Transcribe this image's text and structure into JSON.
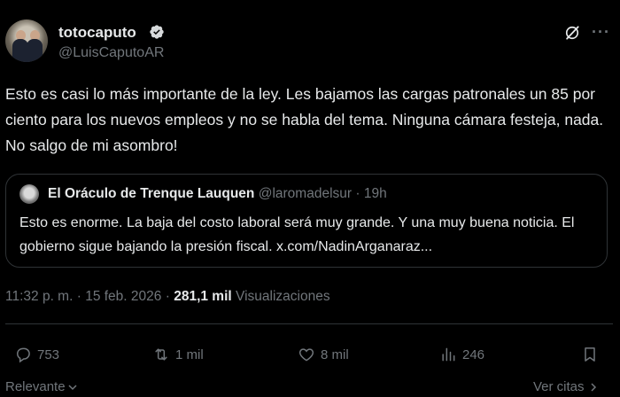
{
  "tweet": {
    "author": {
      "display_name": "totocaputo",
      "handle": "@LuisCaputoAR",
      "verified": true
    },
    "text": "Esto es casi lo más importante de la ley. Les bajamos las cargas patronales un 85 por ciento para los nuevos empleos y no se habla del tema. Ninguna cámara festeja, nada. No salgo de mi asombro!",
    "quote": {
      "author_name": "El Oráculo de Trenque Lauquen",
      "author_handle": "@laromadelsur",
      "separator": "·",
      "time": "19h",
      "text": "Esto es enorme. La baja del costo laboral será muy grande. Y una muy buena noticia. El gobierno sigue bajando la presión fiscal. x.com/NadinArganaraz..."
    },
    "meta": {
      "time": "11:32 p. m.",
      "separator": "·",
      "date": "15 feb. 2026",
      "views_count": "281,1 mil",
      "views_label": "Visualizaciones"
    },
    "actions": {
      "replies": "753",
      "retweets": "1 mil",
      "likes": "8 mil",
      "views": "246"
    },
    "footer": {
      "sort_label": "Relevante",
      "quotes_label": "Ver citas"
    }
  },
  "icons": {
    "verified": "verified-badge-icon",
    "grok": "grok-icon",
    "more": "more-dots-icon",
    "reply": "reply-icon",
    "retweet": "retweet-icon",
    "like": "heart-icon",
    "views": "bar-chart-icon",
    "bookmark": "bookmark-icon"
  },
  "colors": {
    "background": "#000000",
    "text": "#e7e9ea",
    "muted": "#71767b",
    "verified": "#1d9bf0",
    "border": "#2f3336"
  }
}
